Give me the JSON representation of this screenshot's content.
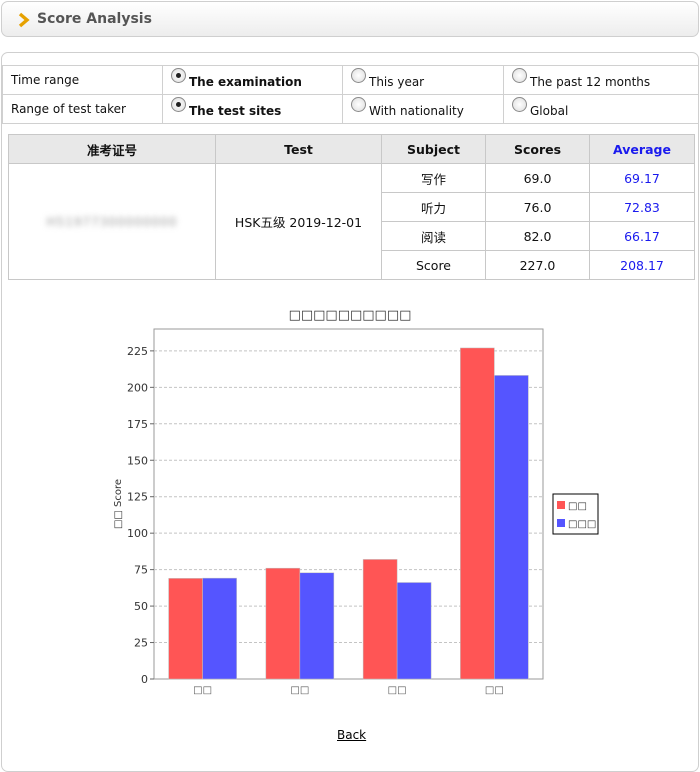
{
  "header": {
    "title": "Score Analysis"
  },
  "filters": {
    "time_range": {
      "label": "Time range",
      "options": [
        "The examination",
        "This year",
        "The past 12 months"
      ],
      "selected": "The examination"
    },
    "test_taker_range": {
      "label": "Range of test taker",
      "options": [
        "The test sites",
        "With nationality",
        "Global"
      ],
      "selected": "The test sites"
    }
  },
  "scores_table": {
    "headers": {
      "id": "准考证号",
      "test": "Test",
      "subject": "Subject",
      "scores": "Scores",
      "average": "Average"
    },
    "candidate_id": "H51977300000000",
    "test": "HSK五级 2019-12-01",
    "rows": [
      {
        "subject": "写作",
        "score": "69.0",
        "average": "69.17"
      },
      {
        "subject": "听力",
        "score": "76.0",
        "average": "72.83"
      },
      {
        "subject": "阅读",
        "score": "82.0",
        "average": "66.17"
      },
      {
        "subject": "Score",
        "score": "227.0",
        "average": "208.17"
      }
    ]
  },
  "chart_data": {
    "type": "bar",
    "title": "□□□□□□□□□□",
    "ylabel": "□□ Score",
    "categories": [
      "□□",
      "□□",
      "□□",
      "□□"
    ],
    "ylim": [
      0,
      240
    ],
    "yticks": [
      0,
      25,
      50,
      75,
      100,
      125,
      150,
      175,
      200,
      225
    ],
    "grid": true,
    "legend": "right",
    "series": [
      {
        "name": "□□",
        "color": "#ff5555",
        "values": [
          69,
          76,
          82,
          227
        ]
      },
      {
        "name": "□□□",
        "color": "#5555ff",
        "values": [
          69.17,
          72.83,
          66.17,
          208.17
        ]
      }
    ]
  },
  "footer": {
    "back_label": "Back"
  }
}
